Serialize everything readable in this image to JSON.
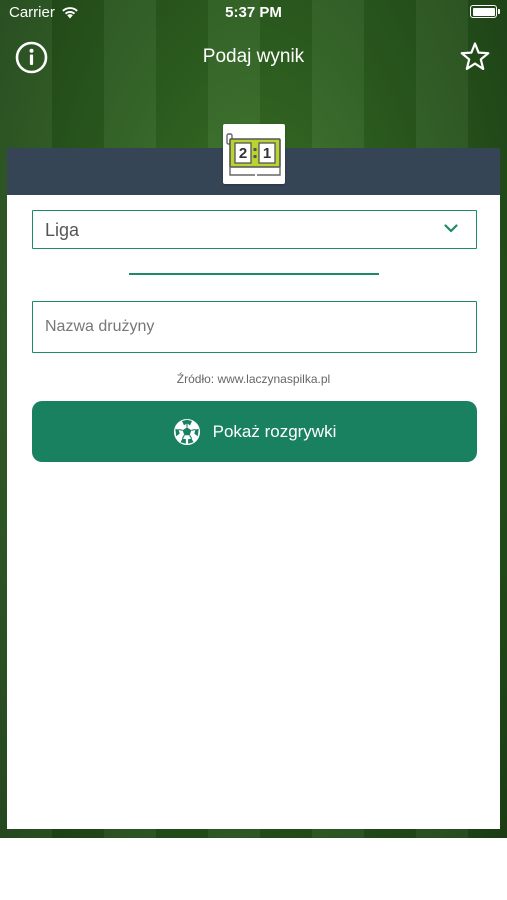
{
  "status_bar": {
    "carrier": "Carrier",
    "time": "5:37 PM",
    "battery_level": 1.0
  },
  "nav": {
    "title": "Podaj wynik",
    "left_icon": "info-icon",
    "right_icon": "star-icon"
  },
  "logo": {
    "score_left": "2",
    "score_right": "1",
    "icon": "scoreboard-icon"
  },
  "form": {
    "league_select_value": "Liga",
    "team_placeholder": "Nazwa drużyny",
    "source_text": "Źródło: www.laczynaspilka.pl",
    "show_button_label": "Pokaż rozgrywki",
    "show_button_icon": "soccer-ball-icon"
  },
  "colors": {
    "accent_green": "#198060",
    "header_slate": "#364556",
    "scoreboard_lime": "#b8d430"
  }
}
